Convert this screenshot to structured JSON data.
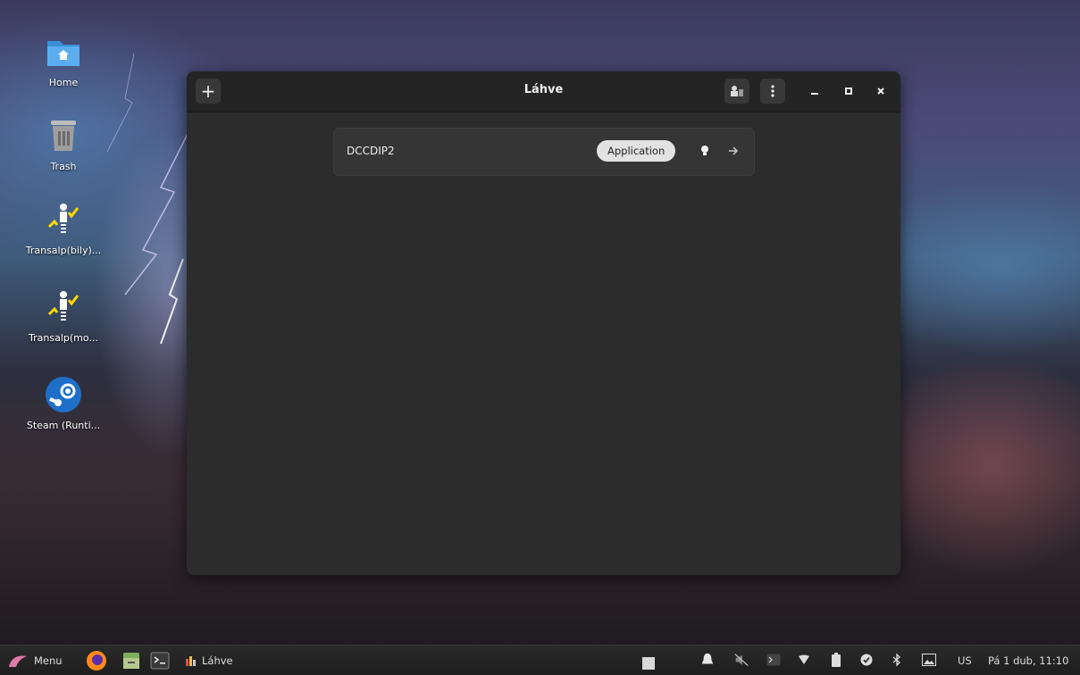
{
  "desktop": {
    "icons": [
      {
        "label": "Home",
        "icon": "folder-home-icon"
      },
      {
        "label": "Trash",
        "icon": "trash-icon"
      },
      {
        "label": "Transalp(bily)...",
        "icon": "transalp-app-icon"
      },
      {
        "label": "Transalp(mo...",
        "icon": "transalp-app-icon"
      },
      {
        "label": "Steam (Runti...",
        "icon": "steam-icon"
      }
    ]
  },
  "window": {
    "title": "Láhve",
    "bottles": [
      {
        "name": "DCCDIP2",
        "environment": "Application"
      }
    ]
  },
  "taskbar": {
    "menu_label": "Menu",
    "active_window_label": "Láhve",
    "keyboard_layout": "US",
    "clock": "Pá 1 dub, 11:10"
  },
  "colors": {
    "window_bg": "#2c2c2c",
    "headerbar_bg": "#242424",
    "badge_bg": "#e2e2e2",
    "taskbar_bg": "#222222"
  }
}
